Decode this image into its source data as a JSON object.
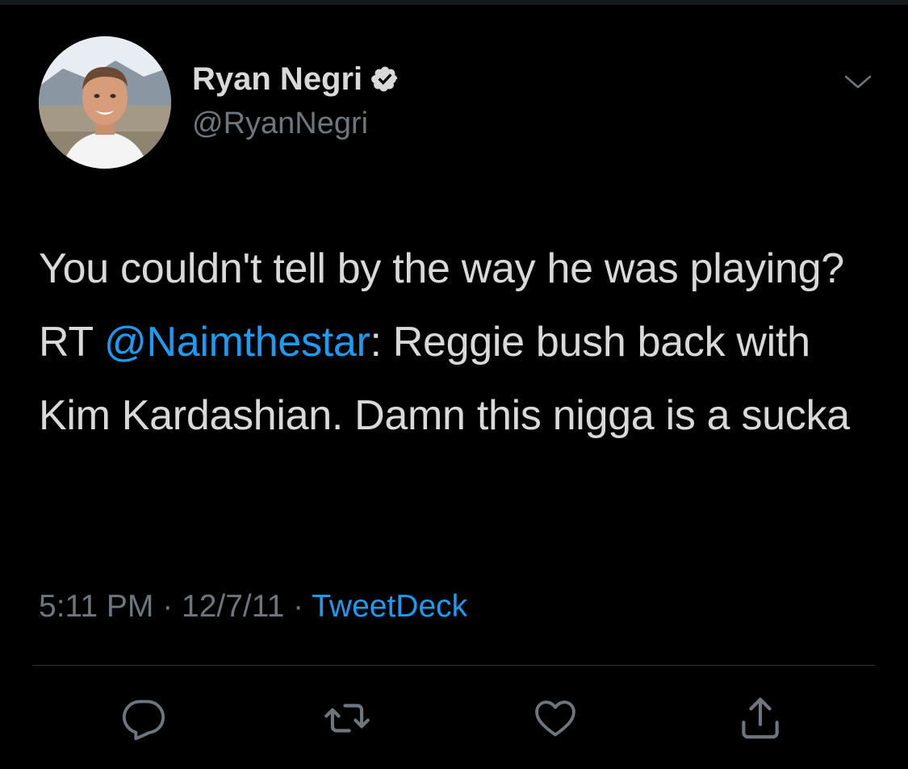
{
  "tweet": {
    "author": {
      "display_name": "Ryan Negri",
      "handle": "@RyanNegri",
      "verified": true,
      "avatar_icon": "profile-photo"
    },
    "text_before_mention": "You couldn't tell by the way he was playing? RT ",
    "mention": "@Naimthestar",
    "text_after_mention": ": Reggie bush back with Kim Kardashian. Damn this nigga is a sucka",
    "time": "5:11 PM",
    "separator": " · ",
    "date": "12/7/11",
    "source": "TweetDeck"
  },
  "actions": [
    {
      "name": "reply",
      "icon": "reply-icon"
    },
    {
      "name": "retweet",
      "icon": "retweet-icon"
    },
    {
      "name": "like",
      "icon": "heart-icon"
    },
    {
      "name": "share",
      "icon": "share-icon"
    }
  ],
  "colors": {
    "background": "#000000",
    "text_primary": "#d9d9d9",
    "text_secondary": "#6e767d",
    "accent": "#1d9bf0",
    "divider": "#2f3336"
  }
}
